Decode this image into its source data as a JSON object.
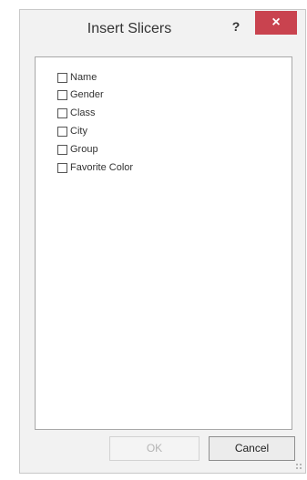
{
  "dialog": {
    "title": "Insert Slicers",
    "help_label": "?",
    "close_label": "×"
  },
  "fields": [
    {
      "label": "Name",
      "checked": false
    },
    {
      "label": "Gender",
      "checked": false
    },
    {
      "label": "Class",
      "checked": false
    },
    {
      "label": "City",
      "checked": false
    },
    {
      "label": "Group",
      "checked": false
    },
    {
      "label": "Favorite Color",
      "checked": false
    }
  ],
  "buttons": {
    "ok_label": "OK",
    "ok_enabled": false,
    "cancel_label": "Cancel"
  },
  "colors": {
    "close_button": "#c9434f",
    "dialog_background": "#f2f2f2"
  }
}
